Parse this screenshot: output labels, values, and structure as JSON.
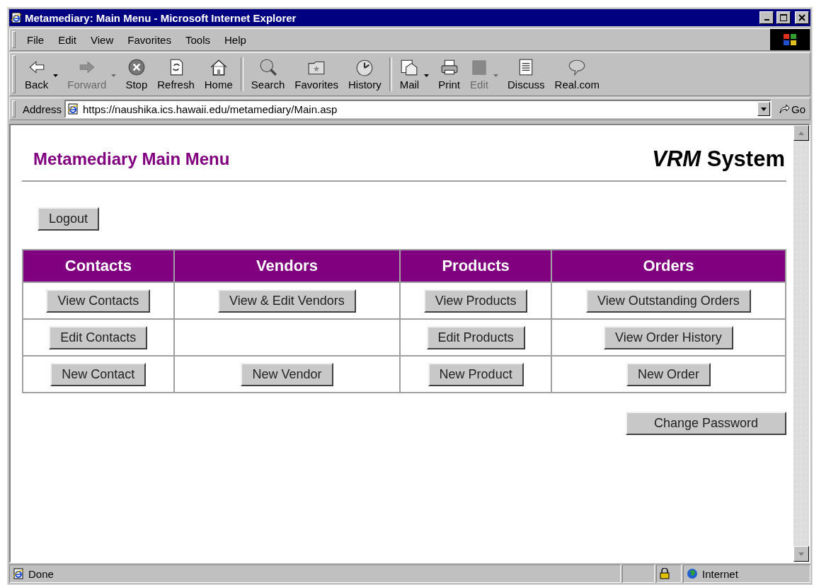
{
  "window": {
    "title": "Metamediary: Main Menu - Microsoft Internet Explorer"
  },
  "menu": [
    {
      "label": "File"
    },
    {
      "label": "Edit"
    },
    {
      "label": "View"
    },
    {
      "label": "Favorites"
    },
    {
      "label": "Tools"
    },
    {
      "label": "Help"
    }
  ],
  "toolbar": [
    [
      {
        "label": "Back",
        "kind": "back",
        "disabled": false,
        "dropdown": true
      },
      {
        "label": "Forward",
        "kind": "forward",
        "disabled": true,
        "dropdown": true
      },
      {
        "label": "Stop",
        "kind": "stop",
        "disabled": false,
        "dropdown": false
      },
      {
        "label": "Refresh",
        "kind": "refresh",
        "disabled": false,
        "dropdown": false
      },
      {
        "label": "Home",
        "kind": "home",
        "disabled": false,
        "dropdown": false
      }
    ],
    [
      {
        "label": "Search",
        "kind": "search",
        "disabled": false,
        "dropdown": false
      },
      {
        "label": "Favorites",
        "kind": "favorites",
        "disabled": false,
        "dropdown": false
      },
      {
        "label": "History",
        "kind": "history",
        "disabled": false,
        "dropdown": false
      }
    ],
    [
      {
        "label": "Mail",
        "kind": "mail",
        "disabled": false,
        "dropdown": true
      },
      {
        "label": "Print",
        "kind": "print",
        "disabled": false,
        "dropdown": false
      },
      {
        "label": "Edit",
        "kind": "edit",
        "disabled": true,
        "dropdown": true
      },
      {
        "label": "Discuss",
        "kind": "discuss",
        "disabled": false,
        "dropdown": false
      },
      {
        "label": "Real.com",
        "kind": "chat",
        "disabled": false,
        "dropdown": false
      }
    ]
  ],
  "address": {
    "label": "Address",
    "value": "https://naushika.ics.hawaii.edu/metamediary/Main.asp",
    "go": "Go"
  },
  "page": {
    "title": "Metamediary Main Menu",
    "system": "*VRM* System",
    "logout": "Logout",
    "columns": [
      "Contacts",
      "Vendors",
      "Products",
      "Orders"
    ],
    "rows": [
      {
        "cells": [
          {
            "kind": "button",
            "label": "View Contacts"
          },
          {
            "kind": "button",
            "label": "View & Edit Vendors"
          },
          {
            "kind": "button",
            "label": "View Products"
          },
          {
            "kind": "button",
            "label": "View Outstanding Orders"
          }
        ]
      },
      {
        "cells": [
          {
            "kind": "button",
            "label": "Edit Contacts"
          },
          {
            "kind": "empty"
          },
          {
            "kind": "button",
            "label": "Edit Products"
          },
          {
            "kind": "button",
            "label": "View Order History"
          }
        ]
      },
      {
        "cells": [
          {
            "kind": "button",
            "label": "New Contact"
          },
          {
            "kind": "button",
            "label": "New Vendor"
          },
          {
            "kind": "button",
            "label": "New Product"
          },
          {
            "kind": "button",
            "label": "New Order"
          }
        ]
      }
    ],
    "change_password": "Change Password"
  },
  "status_bar": {
    "text": "Done",
    "zone": "Internet"
  }
}
